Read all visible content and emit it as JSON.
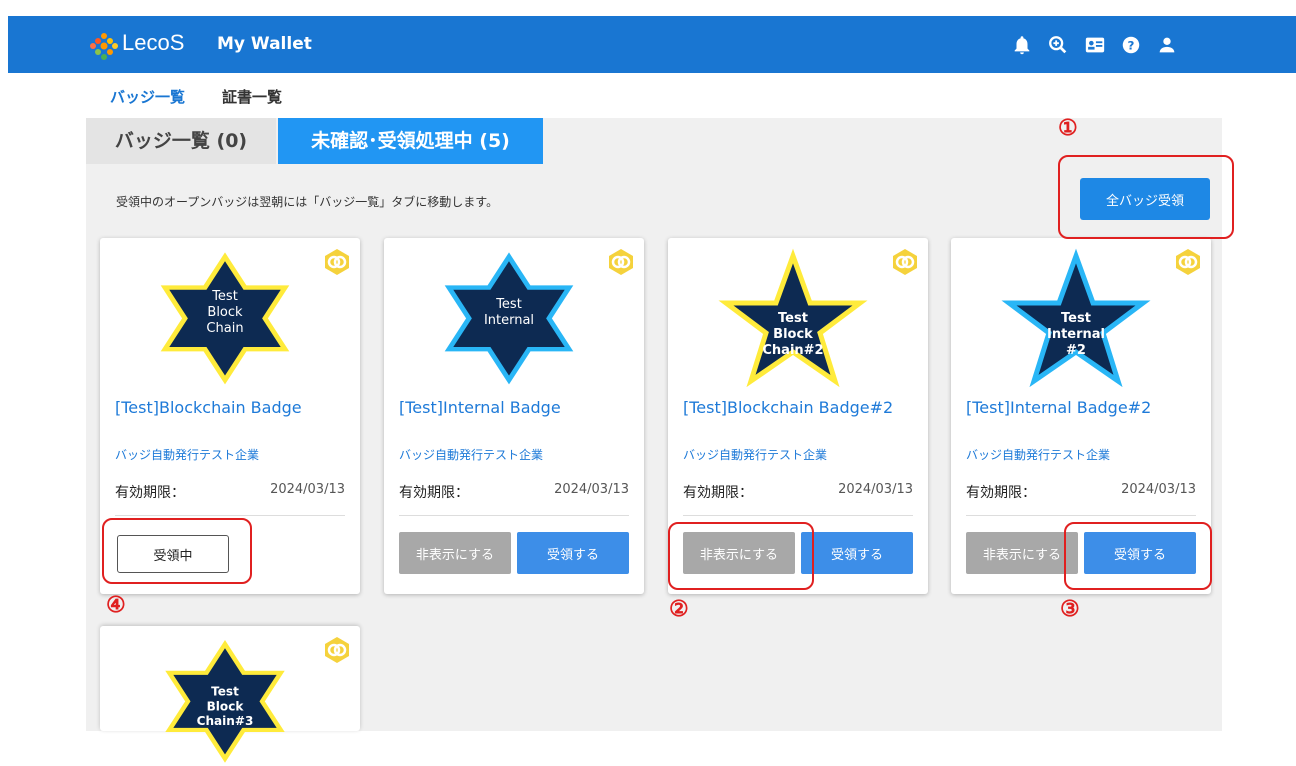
{
  "header": {
    "brand": "LecoS",
    "title": "My Wallet",
    "icons": [
      "bell-icon",
      "zoom-icon",
      "id-card-icon",
      "help-icon",
      "user-icon"
    ]
  },
  "nav": {
    "badges": "バッジ一覧",
    "certs": "証書一覧"
  },
  "tabs": {
    "badge_list": "バッジ一覧 (0)",
    "pending": "未確認･受領処理中 (5)"
  },
  "info_text": "受領中のオープンバッジは翌朝には「バッジ一覧」タブに移動します。",
  "receive_all_label": "全バッジ受領",
  "expiry_label": "有効期限：",
  "hide_label": "非表示にする",
  "receive_label": "受領する",
  "receiving_label": "受領中",
  "cards": [
    {
      "title": "[Test]Blockchain Badge",
      "issuer": "バッジ自動発行テスト企業",
      "expiry": "2024/03/13",
      "star_text": [
        "Test",
        "Block",
        "Chain"
      ]
    },
    {
      "title": "[Test]Internal Badge",
      "issuer": "バッジ自動発行テスト企業",
      "expiry": "2024/03/13",
      "star_text": [
        "Test",
        "Internal"
      ]
    },
    {
      "title": "[Test]Blockchain Badge#2",
      "issuer": "バッジ自動発行テスト企業",
      "expiry": "2024/03/13",
      "star_text": [
        "Test",
        "Block",
        "Chain#2"
      ]
    },
    {
      "title": "[Test]Internal Badge#2",
      "issuer": "バッジ自動発行テスト企業",
      "expiry": "2024/03/13",
      "star_text": [
        "Test",
        "Internal",
        "#2"
      ]
    },
    {
      "star_text": [
        "Test",
        "Block",
        "Chain#3"
      ]
    }
  ],
  "annotations": [
    "①",
    "②",
    "③",
    "④"
  ],
  "colors": {
    "header": "#1976d2",
    "tab_active": "#2196f3",
    "button_primary": "#3d8ee8",
    "annotation": "#e02020"
  }
}
